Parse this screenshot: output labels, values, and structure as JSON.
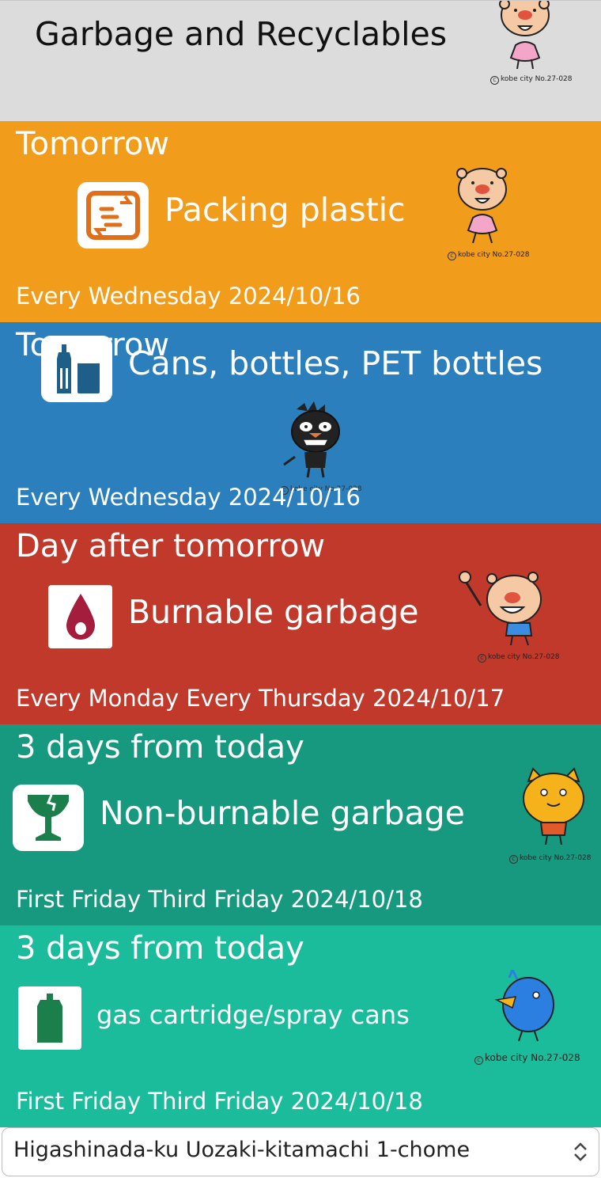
{
  "header": {
    "title": "Garbage and Recyclables",
    "credit": "kobe city No.27-028"
  },
  "colors": {
    "header_bg": "#dcdcdc",
    "packing_plastic": "#f29c1b",
    "cans_bottles": "#2a7fbc",
    "burnable": "#c0392b",
    "non_burnable": "#17997f",
    "gas_cartridge": "#1bbc9b"
  },
  "cards": [
    {
      "when": "Tomorrow",
      "kind": "Packing plastic",
      "schedule": "Every Wednesday 2024/10/16",
      "icon": "packing-plastic-icon",
      "credit": "kobe city No.27-028"
    },
    {
      "when": "Tomorrow",
      "kind": "Cans, bottles, PET bottles",
      "schedule": "Every Wednesday 2024/10/16",
      "icon": "cans-bottles-icon",
      "credit": "kobe city No.27-028"
    },
    {
      "when": "Day after tomorrow",
      "kind": "Burnable garbage",
      "schedule": "Every Monday Every Thursday 2024/10/17",
      "icon": "flame-icon",
      "credit": "kobe city No.27-028"
    },
    {
      "when": "3 days from today",
      "kind": "Non-burnable garbage",
      "schedule": "First Friday Third Friday 2024/10/18",
      "icon": "broken-glass-icon",
      "credit": "kobe city No.27-028"
    },
    {
      "when": "3 days from today",
      "kind": "gas cartridge/spray cans",
      "schedule": "First Friday Third Friday 2024/10/18",
      "icon": "gas-cartridge-icon",
      "credit": "kobe city No.27-028"
    }
  ],
  "area_select": {
    "value": "Higashinada-ku Uozaki-kitamachi 1-chome"
  }
}
